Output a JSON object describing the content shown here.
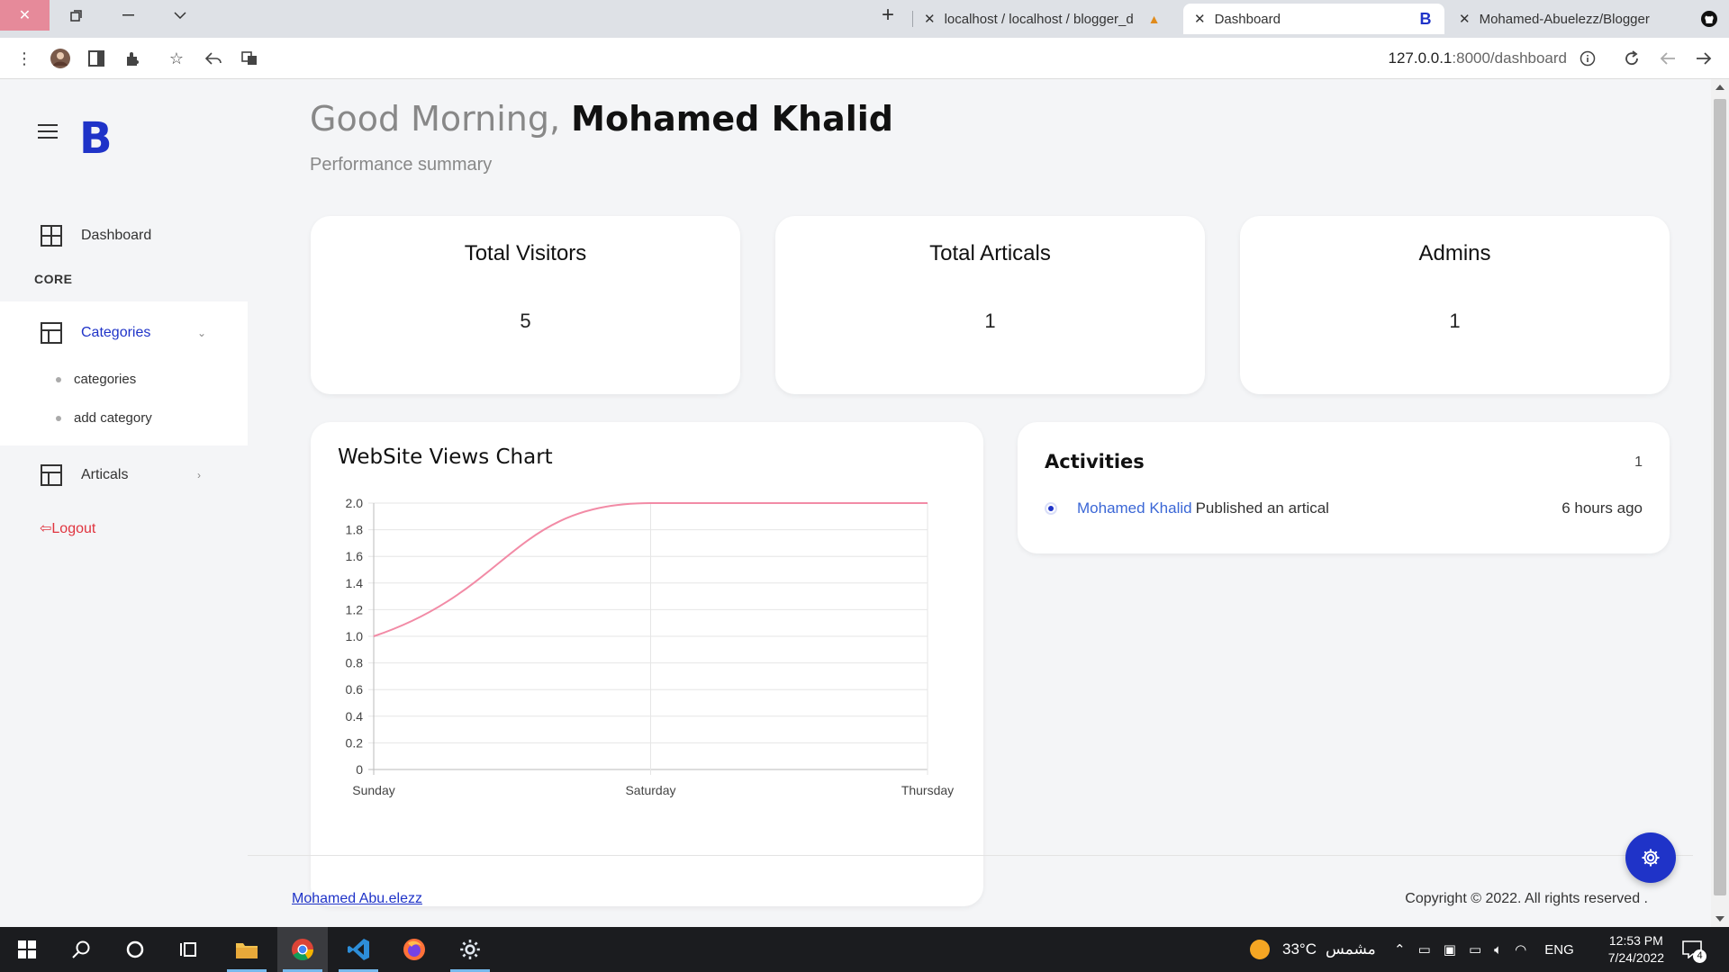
{
  "browser": {
    "tabs": [
      {
        "title": "localhost / localhost / blogger_d",
        "active": false
      },
      {
        "title": "Dashboard",
        "active": true
      },
      {
        "title": "Mohamed-Abuelezz/Blogger",
        "active": false
      }
    ],
    "new_tab_symbol": "+",
    "url_host": "127.0.0.1",
    "url_path": ":8000/dashboard"
  },
  "sidebar": {
    "logo_letter": "B",
    "dashboard_label": "Dashboard",
    "core_label": "CORE",
    "categories_label": "Categories",
    "categories_sub": [
      "categories",
      "add category"
    ],
    "articals_label": "Articals",
    "logout_label": "Logout"
  },
  "header": {
    "greeting_prefix": "Good Morning,",
    "user_name": "Mohamed Khalid",
    "subtitle": "Performance summary"
  },
  "stats": [
    {
      "title": "Total Visitors",
      "value": "5"
    },
    {
      "title": "Total Articals",
      "value": "1"
    },
    {
      "title": "Admins",
      "value": "1"
    }
  ],
  "chart_data": {
    "type": "line",
    "title": "WebSite Views Chart",
    "categories": [
      "Sunday",
      "Saturday",
      "Thursday"
    ],
    "series": [
      {
        "values": [
          1,
          2,
          2
        ],
        "color": "#f28ba6"
      }
    ],
    "ylim": [
      0,
      2
    ],
    "yticks": [
      "0",
      "0.2",
      "0.4",
      "0.6",
      "0.8",
      "1.0",
      "1.2",
      "1.4",
      "1.6",
      "1.8",
      "2.0"
    ],
    "grid": true
  },
  "activities": {
    "title": "Activities",
    "count": "1",
    "items": [
      {
        "user": "Mohamed Khalid",
        "action": "Published an artical",
        "time": "6 hours ago"
      }
    ]
  },
  "footer": {
    "author_link": "Mohamed Abu.elezz",
    "copyright": "Copyright © 2022. All rights reserved ."
  },
  "taskbar": {
    "weather": "33°C",
    "weather_text": "مشمس",
    "language": "ENG",
    "time": "12:53 PM",
    "date": "7/24/2022",
    "notifications": "4"
  },
  "colors": {
    "brand": "#1f33c8",
    "logout": "#e0343f",
    "chart_line": "#f28ba6",
    "link": "#3b67d6"
  }
}
